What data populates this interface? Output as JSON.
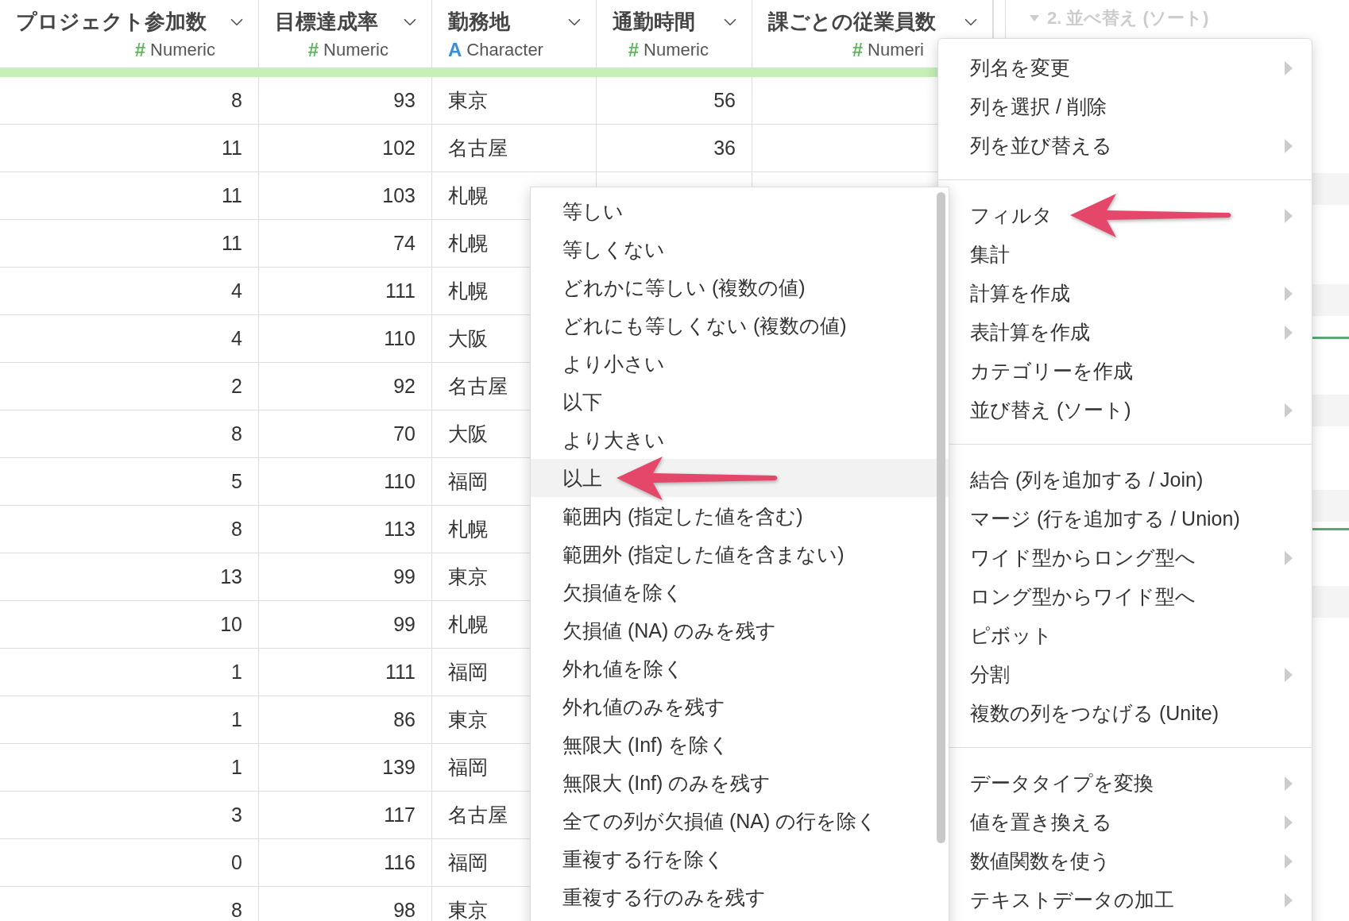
{
  "columns": [
    {
      "name": "プロジェクト参加数",
      "symbol": "#",
      "kind": "numeric",
      "type_label": "Numeric"
    },
    {
      "name": "目標達成率",
      "symbol": "#",
      "kind": "numeric",
      "type_label": "Numeric"
    },
    {
      "name": "勤務地",
      "symbol": "A",
      "kind": "character",
      "type_label": "Character"
    },
    {
      "name": "通勤時間",
      "symbol": "#",
      "kind": "numeric",
      "type_label": "Numeric"
    },
    {
      "name": "課ごとの従業員数",
      "symbol": "#",
      "kind": "numeric",
      "type_label": "Numeri"
    }
  ],
  "rows": [
    {
      "cells": [
        "8",
        "93",
        "東京",
        "56"
      ]
    },
    {
      "cells": [
        "11",
        "102",
        "名古屋",
        "36"
      ]
    },
    {
      "cells": [
        "11",
        "103",
        "札幌"
      ]
    },
    {
      "cells": [
        "11",
        "74",
        "札幌"
      ]
    },
    {
      "cells": [
        "4",
        "111",
        "札幌"
      ]
    },
    {
      "cells": [
        "4",
        "110",
        "大阪"
      ]
    },
    {
      "cells": [
        "2",
        "92",
        "名古屋"
      ]
    },
    {
      "cells": [
        "8",
        "70",
        "大阪"
      ]
    },
    {
      "cells": [
        "5",
        "110",
        "福岡"
      ]
    },
    {
      "cells": [
        "8",
        "113",
        "札幌"
      ]
    },
    {
      "cells": [
        "13",
        "99",
        "東京"
      ]
    },
    {
      "cells": [
        "10",
        "99",
        "札幌"
      ]
    },
    {
      "cells": [
        "1",
        "111",
        "福岡"
      ]
    },
    {
      "cells": [
        "1",
        "86",
        "東京"
      ]
    },
    {
      "cells": [
        "1",
        "139",
        "福岡"
      ]
    },
    {
      "cells": [
        "3",
        "117",
        "名古屋"
      ]
    },
    {
      "cells": [
        "0",
        "116",
        "福岡"
      ]
    },
    {
      "cells": [
        "8",
        "98",
        "東京"
      ]
    }
  ],
  "side_panel": {
    "title": "2. 並べ替え (ソート)"
  },
  "column_menu": {
    "groups": [
      [
        {
          "label": "列名を変更",
          "submenu": true,
          "arrow": false
        },
        {
          "label": "列を選択 / 削除",
          "submenu": false,
          "arrow": false
        },
        {
          "label": "列を並び替える",
          "submenu": true,
          "arrow": false
        }
      ],
      [
        {
          "label": "フィルタ",
          "submenu": true,
          "arrow": true
        },
        {
          "label": "集計",
          "submenu": false,
          "arrow": false
        },
        {
          "label": "計算を作成",
          "submenu": true,
          "arrow": false
        },
        {
          "label": "表計算を作成",
          "submenu": true,
          "arrow": false
        },
        {
          "label": "カテゴリーを作成",
          "submenu": false,
          "arrow": false
        },
        {
          "label": "並び替え (ソート)",
          "submenu": true,
          "arrow": false
        }
      ],
      [
        {
          "label": "結合 (列を追加する / Join)",
          "submenu": false,
          "arrow": false
        },
        {
          "label": "マージ (行を追加する / Union)",
          "submenu": false,
          "arrow": false
        },
        {
          "label": "ワイド型からロング型へ",
          "submenu": true,
          "arrow": false
        },
        {
          "label": "ロング型からワイド型へ",
          "submenu": false,
          "arrow": false
        },
        {
          "label": "ピボット",
          "submenu": false,
          "arrow": false
        },
        {
          "label": "分割",
          "submenu": true,
          "arrow": false
        },
        {
          "label": "複数の列をつなげる (Unite)",
          "submenu": false,
          "arrow": false
        }
      ],
      [
        {
          "label": "データタイプを変換",
          "submenu": true,
          "arrow": false
        },
        {
          "label": "値を置き換える",
          "submenu": true,
          "arrow": false
        },
        {
          "label": "数値関数を使う",
          "submenu": true,
          "arrow": false
        },
        {
          "label": "テキストデータの加工",
          "submenu": true,
          "arrow": false
        }
      ]
    ]
  },
  "filter_submenu": {
    "items": [
      {
        "label": "等しい",
        "selected": false,
        "arrow": false
      },
      {
        "label": "等しくない",
        "selected": false,
        "arrow": false
      },
      {
        "label": "どれかに等しい (複数の値)",
        "selected": false,
        "arrow": false
      },
      {
        "label": "どれにも等しくない (複数の値)",
        "selected": false,
        "arrow": false
      },
      {
        "label": "より小さい",
        "selected": false,
        "arrow": false
      },
      {
        "label": "以下",
        "selected": false,
        "arrow": false
      },
      {
        "label": "より大きい",
        "selected": false,
        "arrow": false
      },
      {
        "label": "以上",
        "selected": true,
        "arrow": true
      },
      {
        "label": "範囲内 (指定した値を含む)",
        "selected": false,
        "arrow": false
      },
      {
        "label": "範囲外 (指定した値を含まない)",
        "selected": false,
        "arrow": false
      },
      {
        "label": "欠損値を除く",
        "selected": false,
        "arrow": false
      },
      {
        "label": "欠損値 (NA) のみを残す",
        "selected": false,
        "arrow": false
      },
      {
        "label": "外れ値を除く",
        "selected": false,
        "arrow": false
      },
      {
        "label": "外れ値のみを残す",
        "selected": false,
        "arrow": false
      },
      {
        "label": "無限大 (Inf) を除く",
        "selected": false,
        "arrow": false
      },
      {
        "label": "無限大 (Inf) のみを残す",
        "selected": false,
        "arrow": false
      },
      {
        "label": "全ての列が欠損値 (NA) の行を除く",
        "selected": false,
        "arrow": false
      },
      {
        "label": "重複する行を除く",
        "selected": false,
        "arrow": false
      },
      {
        "label": "重複する行のみを残す",
        "selected": false,
        "arrow": false
      }
    ]
  }
}
